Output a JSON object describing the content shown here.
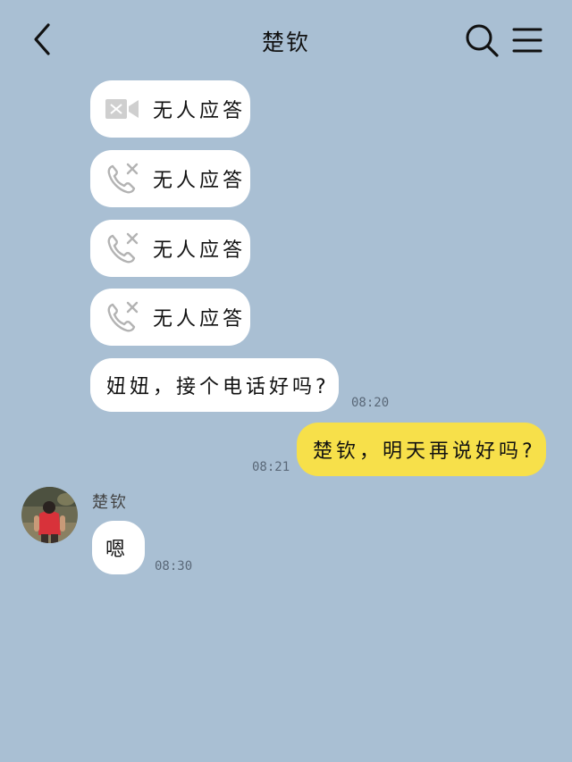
{
  "header": {
    "title": "楚钦"
  },
  "messages": {
    "video_missed": {
      "text": "无人应答",
      "icon": "video-call-missed-icon"
    },
    "call_missed_1": {
      "text": "无人应答",
      "icon": "phone-missed-icon"
    },
    "call_missed_2": {
      "text": "无人应答",
      "icon": "phone-missed-icon"
    },
    "call_missed_3": {
      "text": "无人应答",
      "icon": "phone-missed-icon"
    },
    "msg1": {
      "text": "妞妞，接个电话好吗?",
      "time": "08:20"
    },
    "msg2": {
      "text": "楚钦，明天再说好吗?",
      "time": "08:21"
    },
    "msg3": {
      "sender": "楚钦",
      "text": "嗯",
      "time": "08:30"
    }
  },
  "colors": {
    "background": "#a9bfd3",
    "my_bubble": "#f7e04a",
    "their_bubble": "#ffffff"
  }
}
